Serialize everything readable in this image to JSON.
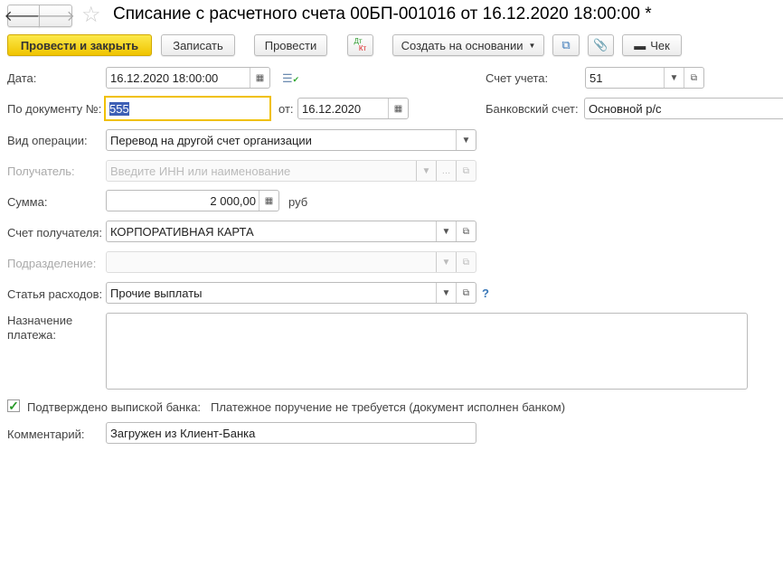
{
  "title": "Списание с расчетного счета 00БП-001016 от 16.12.2020 18:00:00 *",
  "toolbar": {
    "post_close": "Провести и закрыть",
    "save": "Записать",
    "post": "Провести",
    "dt": "Дт",
    "kt": "Кт",
    "create_based": "Создать на основании",
    "check": "Чек"
  },
  "fields": {
    "date_label": "Дата:",
    "date": "16.12.2020 18:00:00",
    "docnum_label": "По документу №:",
    "docnum": "555",
    "from_label": "от:",
    "from_date": "16.12.2020",
    "account_label": "Счет учета:",
    "account": "51",
    "bank_label": "Банковский счет:",
    "bank": "Основной р/с",
    "op_label": "Вид операции:",
    "op": "Перевод на другой счет организации",
    "recipient_label": "Получатель:",
    "recipient_placeholder": "Введите ИНН или наименование",
    "sum_label": "Сумма:",
    "sum": "2 000,00",
    "currency": "руб",
    "recv_account_label": "Счет получателя:",
    "recv_account": "КОРПОРАТИВНАЯ КАРТА",
    "division_label": "Подразделение:",
    "division": "",
    "expense_label": "Статья расходов:",
    "expense": "Прочие выплаты",
    "help": "?",
    "purpose_label": "Назначение платежа:",
    "purpose": "",
    "confirmed_label": "Подтверждено выпиской банка:",
    "confirmed": true,
    "confirmed_note": "Платежное поручение не требуется (документ исполнен банком)",
    "comment_label": "Комментарий:",
    "comment": "Загружен из Клиент-Банка"
  }
}
